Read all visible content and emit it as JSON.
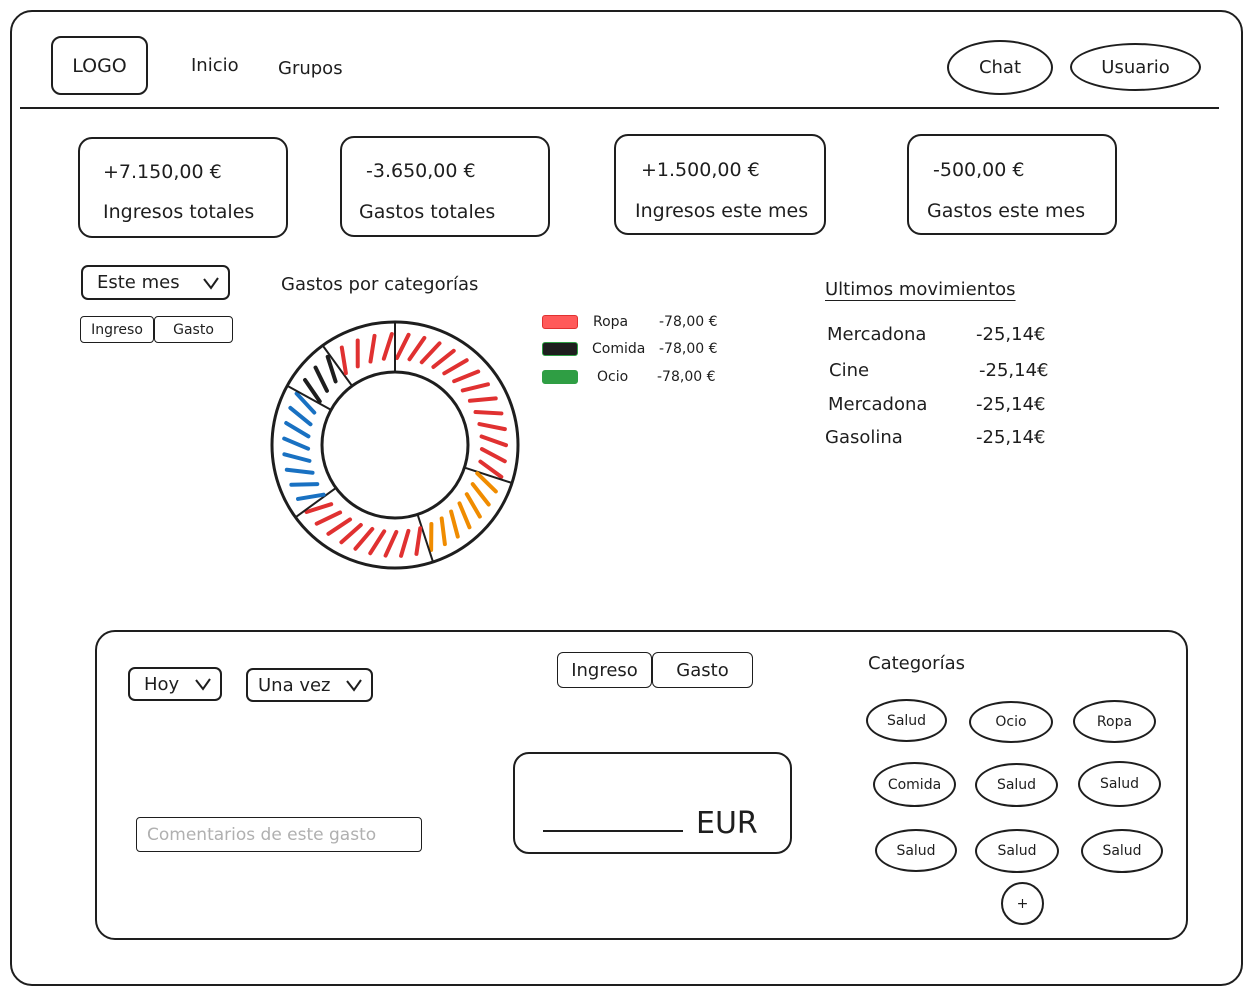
{
  "header": {
    "logo": "LOGO",
    "nav": [
      "Inicio",
      "Grupos"
    ],
    "chat_label": "Chat",
    "user_label": "Usuario"
  },
  "stats": [
    {
      "value": "+7.150,00 €",
      "label": "Ingresos totales"
    },
    {
      "value": "-3.650,00 €",
      "label": "Gastos totales"
    },
    {
      "value": "+1.500,00 €",
      "label": "Ingresos este mes"
    },
    {
      "value": "-500,00 €",
      "label": "Gastos este mes"
    }
  ],
  "filters": {
    "period": "Este mes",
    "toggle": [
      "Ingreso",
      "Gasto"
    ]
  },
  "chart": {
    "title": "Gastos por categorías",
    "legend": [
      {
        "name": "Ropa",
        "value": "-78,00 €",
        "color": "#e03131"
      },
      {
        "name": "Comida",
        "value": "-78,00 €",
        "color": "#1e1e1e"
      },
      {
        "name": "Ocio",
        "value": "-78,00 €",
        "color": "#2f9e44"
      }
    ]
  },
  "chart_data": {
    "type": "pie",
    "title": "Gastos por categorías",
    "slices": [
      {
        "color": "#e03131",
        "value": 30
      },
      {
        "color": "#f08c00",
        "value": 15
      },
      {
        "color": "#e03131",
        "value": 20
      },
      {
        "color": "#1971c2",
        "value": 18
      },
      {
        "color": "#1e1e1e",
        "value": 7
      },
      {
        "color": "#e03131",
        "value": 10
      }
    ]
  },
  "movements": {
    "title": "Ultimos movimientos",
    "items": [
      {
        "name": "Mercadona",
        "amount": "-25,14€"
      },
      {
        "name": "Cine",
        "amount": "-25,14€"
      },
      {
        "name": "Mercadona",
        "amount": "-25,14€"
      },
      {
        "name": "Gasolina",
        "amount": "-25,14€"
      }
    ]
  },
  "form": {
    "date": "Hoy",
    "frequency": "Una vez",
    "toggle": [
      "Ingreso",
      "Gasto"
    ],
    "currency": "EUR",
    "comment_placeholder": "Comentarios de este gasto",
    "categories_title": "Categorías",
    "categories": [
      "Salud",
      "Ocio",
      "Ropa",
      "Comida",
      "Salud",
      "Salud",
      "Salud",
      "Salud",
      "Salud"
    ],
    "add_label": "+"
  }
}
